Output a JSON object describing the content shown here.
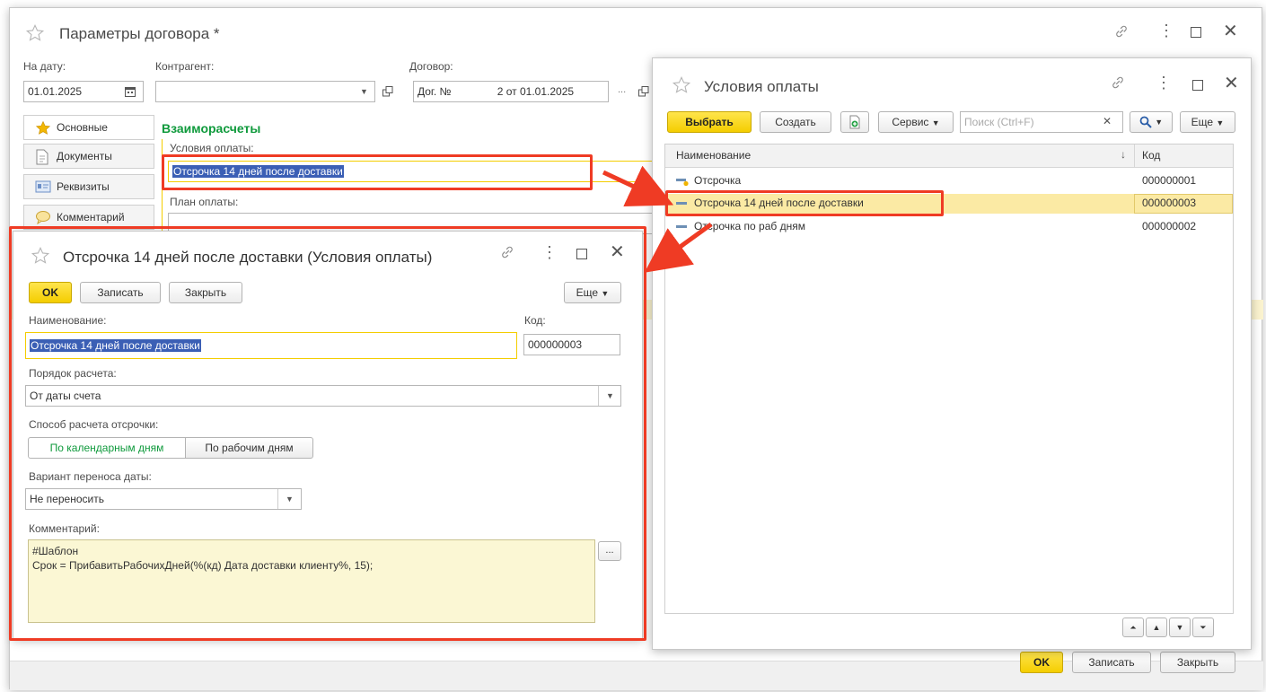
{
  "main_window": {
    "title": "Параметры договора *",
    "date_label": "На дату:",
    "date_value": "01.01.2025",
    "counterparty_label": "Контрагент:",
    "counterparty_value": "",
    "contract_label": "Договор:",
    "contract_value_prefix": "Дог. №",
    "contract_value_suffix": "2 от 01.01.2025",
    "tabs": [
      {
        "label": "Основные"
      },
      {
        "label": "Документы"
      },
      {
        "label": "Реквизиты"
      },
      {
        "label": "Комментарий"
      }
    ],
    "section_title": "Взаиморасчеты",
    "payment_terms_label": "Условия оплаты:",
    "payment_terms_value": "Отсрочка 14 дней после доставки",
    "payment_plan_label": "План оплаты:",
    "ok_label": "OK",
    "save_label": "Записать",
    "close_label": "Закрыть"
  },
  "payment_terms_list": {
    "title": "Условия оплаты",
    "select_label": "Выбрать",
    "create_label": "Создать",
    "service_label": "Сервис",
    "search_placeholder": "Поиск (Ctrl+F)",
    "more_label": "Еще",
    "col_name": "Наименование",
    "col_code": "Код",
    "rows": [
      {
        "name": "Отсрочка",
        "code": "000000001"
      },
      {
        "name": "Отсрочка 14 дней после доставки",
        "code": "000000003"
      },
      {
        "name": "Отсрочка по раб дням",
        "code": "000000002"
      }
    ]
  },
  "item_form": {
    "title": "Отсрочка 14 дней после доставки (Условия оплаты)",
    "ok_label": "OK",
    "save_label": "Записать",
    "close_label": "Закрыть",
    "more_label": "Еще",
    "name_label": "Наименование:",
    "name_value": "Отсрочка 14 дней после доставки",
    "code_label": "Код:",
    "code_value": "000000003",
    "calc_order_label": "Порядок расчета:",
    "calc_order_value": "От даты счета",
    "delay_method_label": "Способ расчета отсрочки:",
    "delay_method_options": [
      "По календарным дням",
      "По рабочим дням"
    ],
    "date_shift_label": "Вариант переноса даты:",
    "date_shift_value": "Не переносить",
    "comment_label": "Комментарий:",
    "comment_line1": "#Шаблон",
    "comment_line2": "Срок = ПрибавитьРабочихДней(%(кд) Дата доставки клиенту%, 15);",
    "ellipsis": "..."
  },
  "colors": {
    "accent_yellow": "#f4cd00",
    "highlight_red": "#ef3b24",
    "green_text": "#0f9a3c",
    "selection_blue": "#3b5fb5"
  }
}
